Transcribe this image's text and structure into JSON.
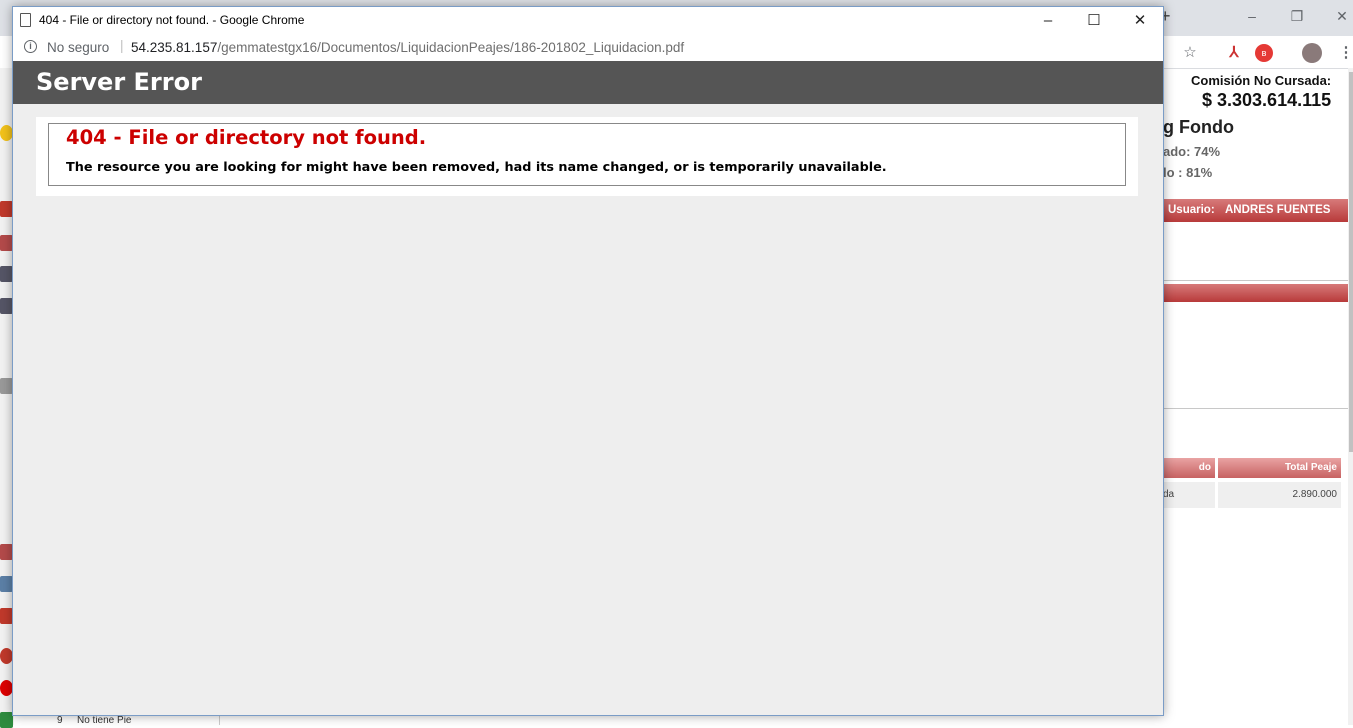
{
  "popup": {
    "title": "404 - File or directory not found. - Google Chrome",
    "security_label": "No seguro",
    "address_separator": "|",
    "url_host": "54.235.81.157",
    "url_path": "/gemmatestgx16/Documentos/LiquidacionPeajes/186-201802_Liquidacion.pdf",
    "controls": {
      "minimize": "–",
      "maximize": "☐",
      "close": "✕"
    }
  },
  "error_page": {
    "header": "Server Error",
    "title": "404 - File or directory not found.",
    "message": "The resource you are looking for might have been removed, had its name changed, or is temporarily unavailable."
  },
  "background": {
    "new_tab": "+",
    "commission_label": "Comisión No Cursada:",
    "commission_value": "$ 3.303.614.115",
    "fondo_partial": "g Fondo",
    "stat1_partial": "ado: 74%",
    "stat2_partial": "lo : 81%",
    "user_label": "Usuario:",
    "user_name": "ANDRES FUENTES",
    "table_header_partial": "do",
    "table_header_total": "Total Peaje",
    "table_cell_partial": "da",
    "table_cell_total": "2.890.000",
    "bottom_row_number": "9",
    "bottom_row_text": "No tiene Pie",
    "window_controls": {
      "minimize": "–",
      "restore": "❐",
      "close": "✕"
    }
  },
  "colors": {
    "error_red": "#cc0000",
    "header_gray": "#555555",
    "accent_red_bar": "#b83a3a"
  }
}
